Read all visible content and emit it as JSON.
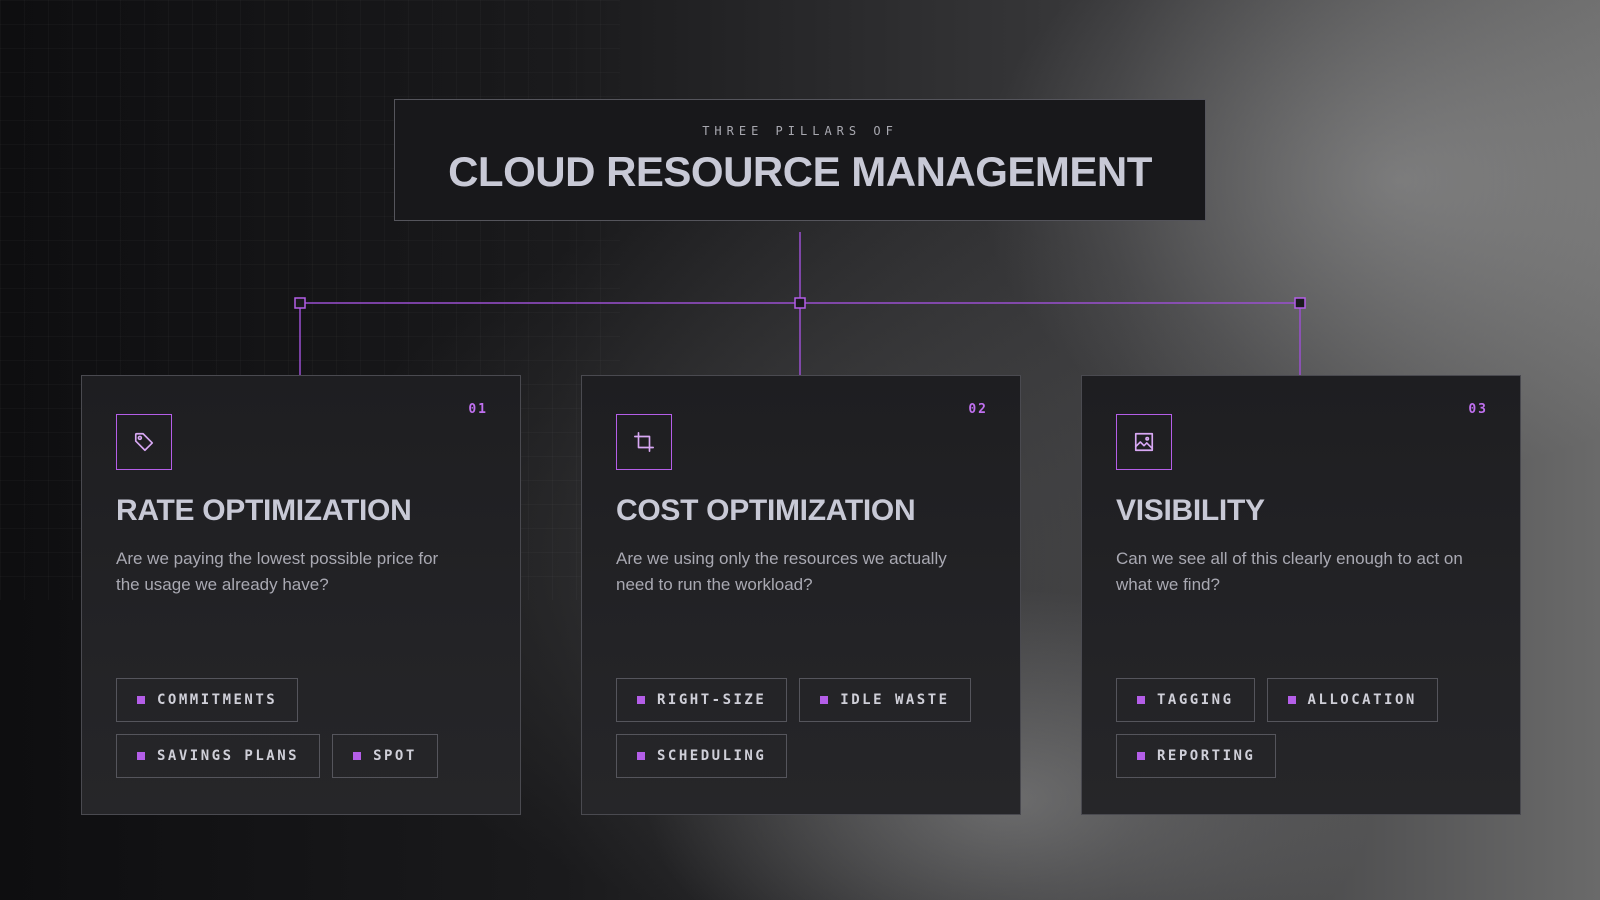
{
  "header": {
    "kicker": "THREE PILLARS OF",
    "title": "CLOUD RESOURCE MANAGEMENT"
  },
  "colors": {
    "accent": "#b45ee8",
    "title_text": "#c8c9d6",
    "card_bg": "#1e1e21"
  },
  "pillars": [
    {
      "number": "01",
      "icon": "tag-icon",
      "title": "RATE OPTIMIZATION",
      "description": "Are we paying the lowest possible price for the usage we already have?",
      "tags": [
        "COMMITMENTS",
        "SAVINGS PLANS",
        "SPOT"
      ]
    },
    {
      "number": "02",
      "icon": "crop-icon",
      "title": "COST OPTIMIZATION",
      "description": "Are we using only the resources we actually need to run the workload?",
      "tags": [
        "RIGHT-SIZE",
        "IDLE WASTE",
        "SCHEDULING"
      ]
    },
    {
      "number": "03",
      "icon": "image-icon",
      "title": "VISIBILITY",
      "description": "Can we see all of this clearly enough to act on what we find?",
      "tags": [
        "TAGGING",
        "ALLOCATION",
        "REPORTING"
      ]
    }
  ]
}
